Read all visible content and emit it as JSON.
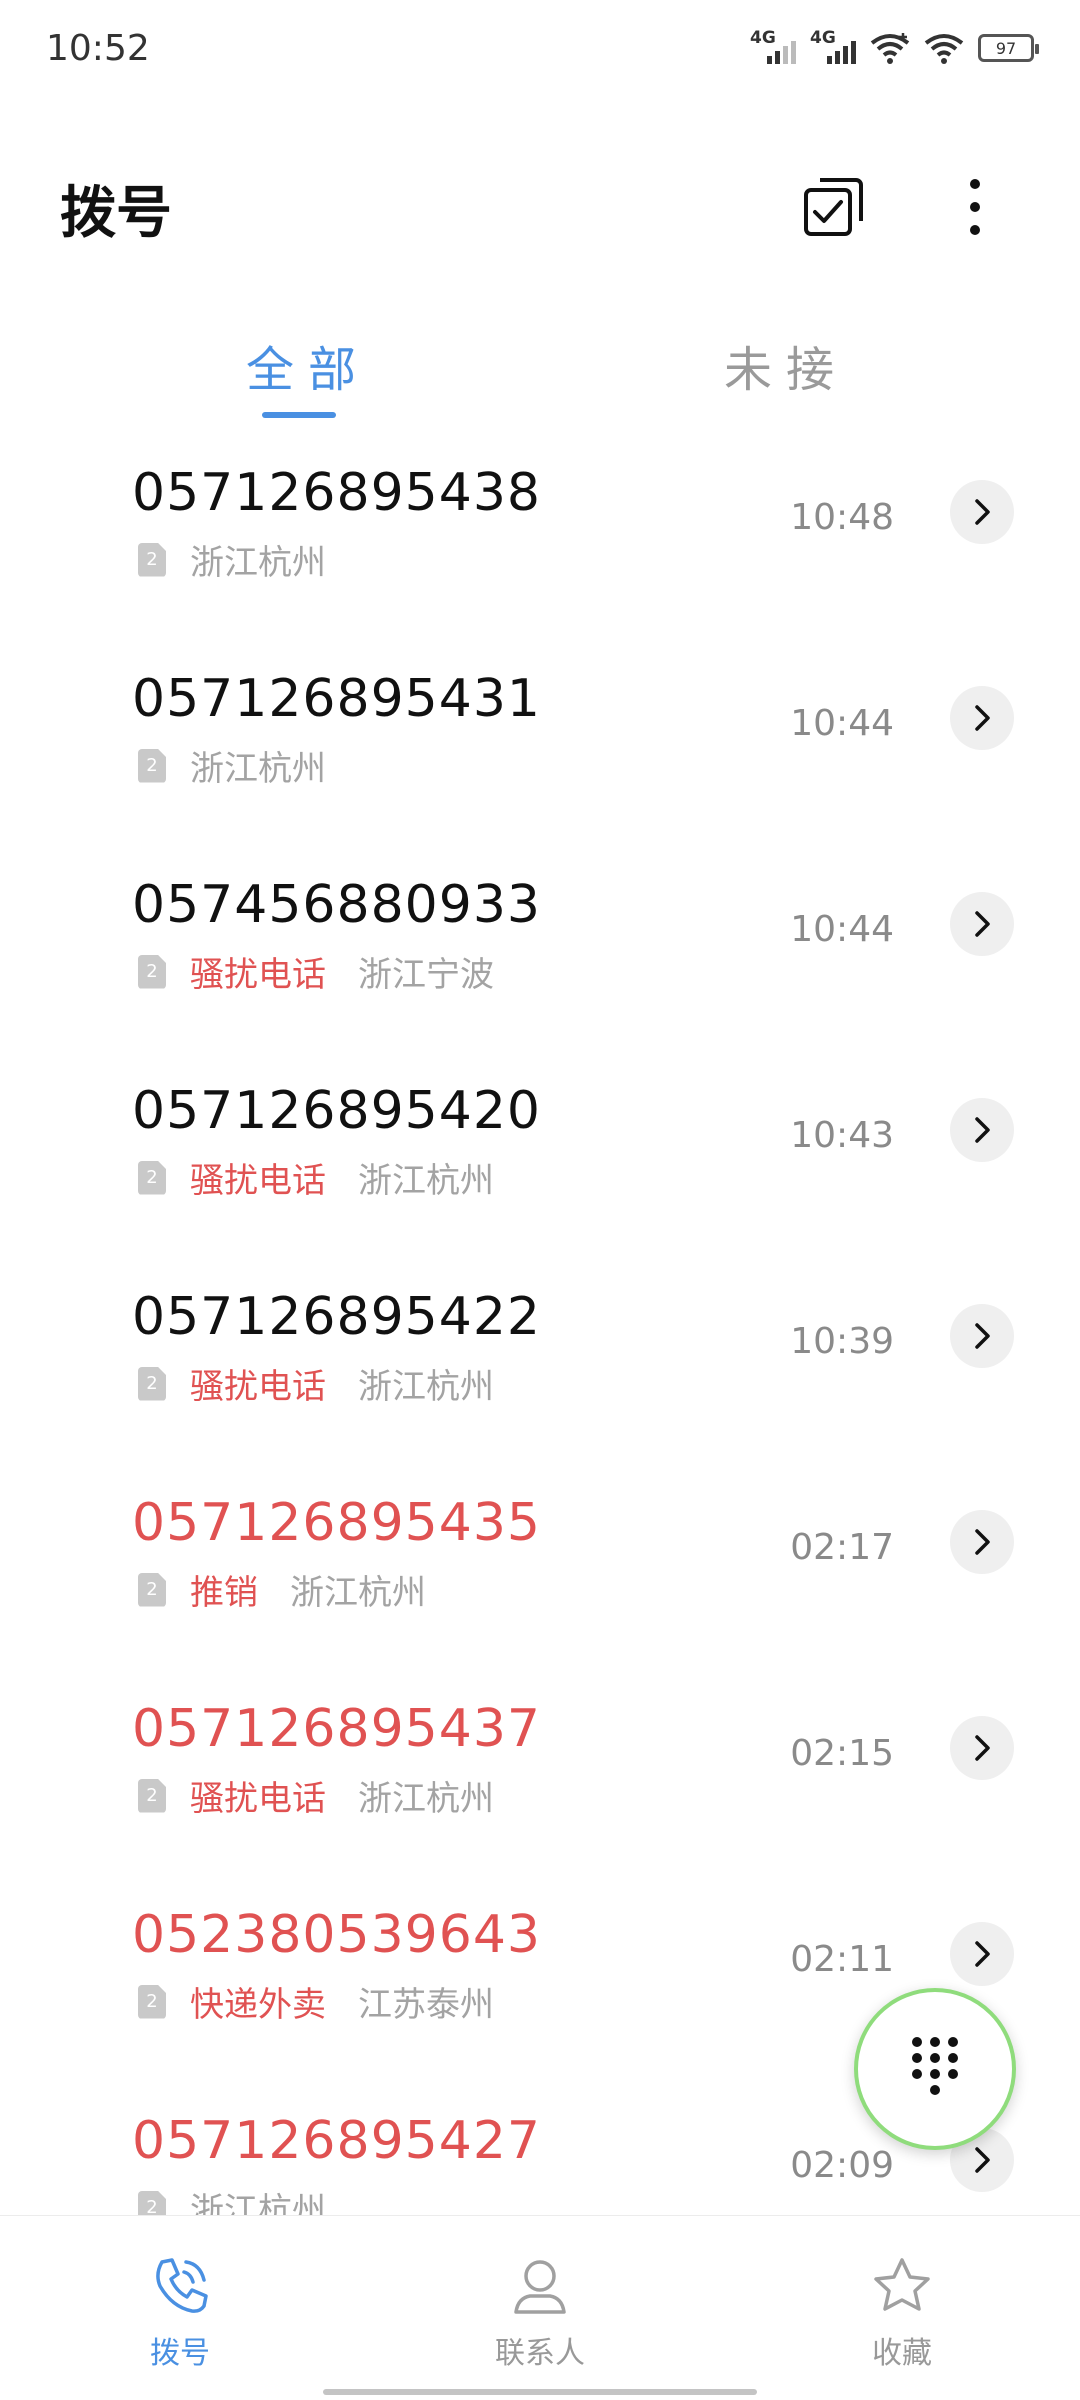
{
  "status_bar": {
    "time": "10:52",
    "signal1_label": "4G",
    "signal2_label": "4G",
    "battery": "97"
  },
  "header": {
    "title": "拨号"
  },
  "tabs": [
    {
      "label": "全部",
      "active": true
    },
    {
      "label": "未接",
      "active": false
    }
  ],
  "calls": [
    {
      "number": "057126895438",
      "missed": false,
      "tag": "",
      "location": "浙江杭州",
      "time": "10:48",
      "sim": "2"
    },
    {
      "number": "057126895431",
      "missed": false,
      "tag": "",
      "location": "浙江杭州",
      "time": "10:44",
      "sim": "2"
    },
    {
      "number": "057456880933",
      "missed": false,
      "tag": "骚扰电话",
      "location": "浙江宁波",
      "time": "10:44",
      "sim": "2"
    },
    {
      "number": "057126895420",
      "missed": false,
      "tag": "骚扰电话",
      "location": "浙江杭州",
      "time": "10:43",
      "sim": "2"
    },
    {
      "number": "057126895422",
      "missed": false,
      "tag": "骚扰电话",
      "location": "浙江杭州",
      "time": "10:39",
      "sim": "2"
    },
    {
      "number": "057126895435",
      "missed": true,
      "tag": "推销",
      "location": "浙江杭州",
      "time": "02:17",
      "sim": "2"
    },
    {
      "number": "057126895437",
      "missed": true,
      "tag": "骚扰电话",
      "location": "浙江杭州",
      "time": "02:15",
      "sim": "2"
    },
    {
      "number": "052380539643",
      "missed": true,
      "tag": "快递外卖",
      "location": "江苏泰州",
      "time": "02:11",
      "sim": "2"
    },
    {
      "number": "057126895427",
      "missed": true,
      "tag": "",
      "location": "浙江杭州",
      "time": "02:09",
      "sim": "2"
    }
  ],
  "bottom_nav": [
    {
      "label": "拨号",
      "icon": "phone-icon",
      "active": true
    },
    {
      "label": "联系人",
      "icon": "person-icon",
      "active": false
    },
    {
      "label": "收藏",
      "icon": "star-icon",
      "active": false
    }
  ],
  "colors": {
    "accent": "#4a90e2",
    "missed_red": "#e05252",
    "fab_border": "#8fdc7c"
  }
}
